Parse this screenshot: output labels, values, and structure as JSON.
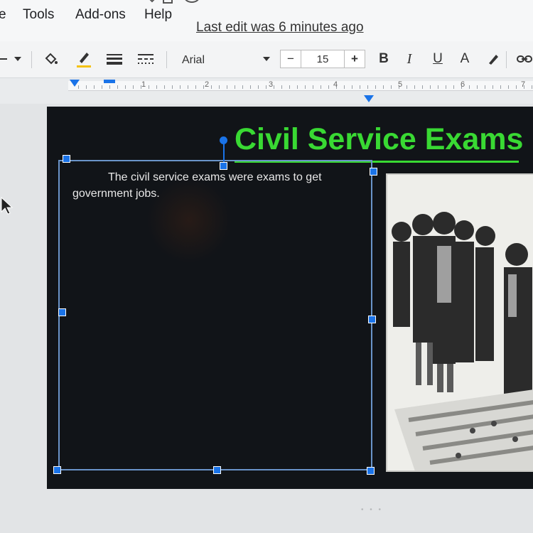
{
  "menu": {
    "file_fragment": "e",
    "tools": "Tools",
    "addons": "Add-ons",
    "help": "Help",
    "last_edit": "Last edit was 6 minutes ago"
  },
  "toolbar": {
    "font_name": "Arial",
    "font_size": "15",
    "minus": "−",
    "plus": "+",
    "bold": "B",
    "italic": "I",
    "underline": "U",
    "text_color": "A"
  },
  "ruler": {
    "numbers": [
      "1",
      "2",
      "3",
      "4",
      "5",
      "6",
      "7"
    ]
  },
  "slide": {
    "title": "Civil Service Exams",
    "body": "The civil service exams were exams to get government jobs.",
    "title_color": "#39d933",
    "background_color": "#111418"
  },
  "icons": {
    "paint": "paint-bucket-icon",
    "pen": "pen-icon",
    "line_weight": "line-weight-icon",
    "line_dash": "line-dash-icon",
    "highlight": "highlighter-icon",
    "link": "link-icon"
  }
}
